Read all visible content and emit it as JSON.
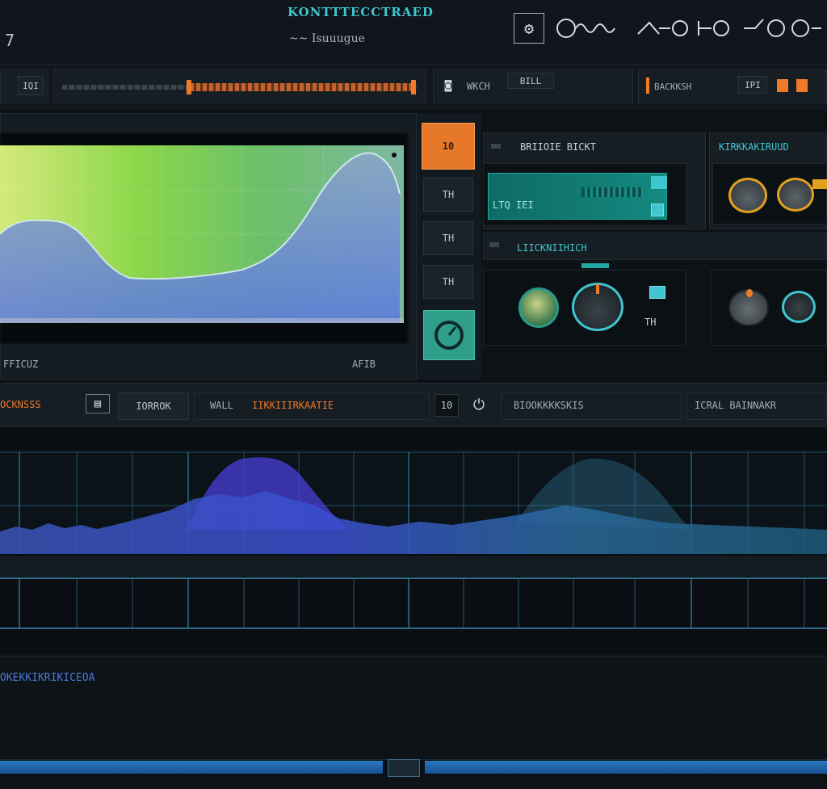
{
  "window": {
    "corner_label": "7",
    "title": "KONTTTECCTRAED",
    "subtitle": "~~ Isuuugue"
  },
  "header_icons": [
    "settings-icon",
    "waveform-icon",
    "route-icon",
    "node-icon",
    "link-icon"
  ],
  "toolbar": {
    "left_badge": "IQI",
    "seg2_label": "WKCH",
    "seg2_value": "BILL",
    "seg3_label": "BACKKSH",
    "seg3_badge": "IPI"
  },
  "spectrum": {
    "footer_left": "FFICUZ",
    "footer_right": "AFIB"
  },
  "side_buttons": {
    "top": "10",
    "b1": "TH",
    "b2": "TH",
    "b3": "TH"
  },
  "module_a": {
    "title": "BRIIOIE BICKT",
    "display_value": "LTQ  IEI"
  },
  "module_b": {
    "title": "KIRKKAKIRUUD"
  },
  "module_c": {
    "title": "LIICKNIIHICH",
    "mini_label": "TH"
  },
  "strip": {
    "label1": "OCKNSSS",
    "button1": "IORROK",
    "label2": "WALL",
    "label2_value": "IIKKIIIRKAATIE",
    "button2": "10",
    "field1": "BIOOKKKKSKIS",
    "field2": "ICRAL  BAINNAKR"
  },
  "footer_text": "OKEKKIKRIKICEOA",
  "colors": {
    "accent_teal": "#3fc6d0",
    "accent_orange": "#f07a2a",
    "bg": "#0d1217"
  }
}
